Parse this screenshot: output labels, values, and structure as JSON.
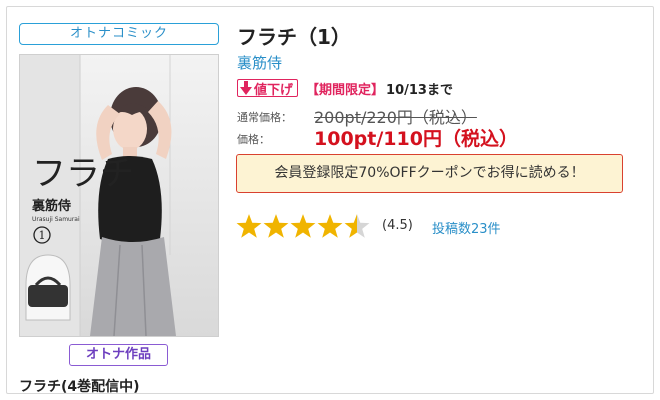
{
  "category_badge": "オトナコミック",
  "cover": {
    "title_text": "フラチ",
    "author_text": "裏筋侍",
    "author_romaji": "Urasuji Samurai",
    "volume": "1"
  },
  "adult_badge": "オトナ作品",
  "series_label": "フラチ(4巻配信中)",
  "product": {
    "title": "フラチ（1）",
    "author": "裏筋侍"
  },
  "discount": {
    "badge_label": "値下げ",
    "limited_label": "【期間限定】",
    "until_text": "10/13まで"
  },
  "pricing": {
    "regular_label": "通常価格：",
    "regular_price": "200pt/220円（税込）",
    "sale_label": "価格：",
    "sale_price": "100pt/110円（税込）"
  },
  "coupon_text": "会員登録限定70%OFFクーポンでお得に読める！",
  "review": {
    "rating_value": 4.5,
    "rating_text": "(4.5)",
    "count_text": "投稿数23件",
    "star_color": "#f0b400",
    "star_empty_color": "#d6d6d6"
  },
  "colors": {
    "accent_blue": "#2a8fc8",
    "accent_pink": "#e0245e",
    "sale_red": "#d4111e",
    "coupon_bg": "#fdf3d3",
    "adult_purple": "#6d3fbf"
  }
}
